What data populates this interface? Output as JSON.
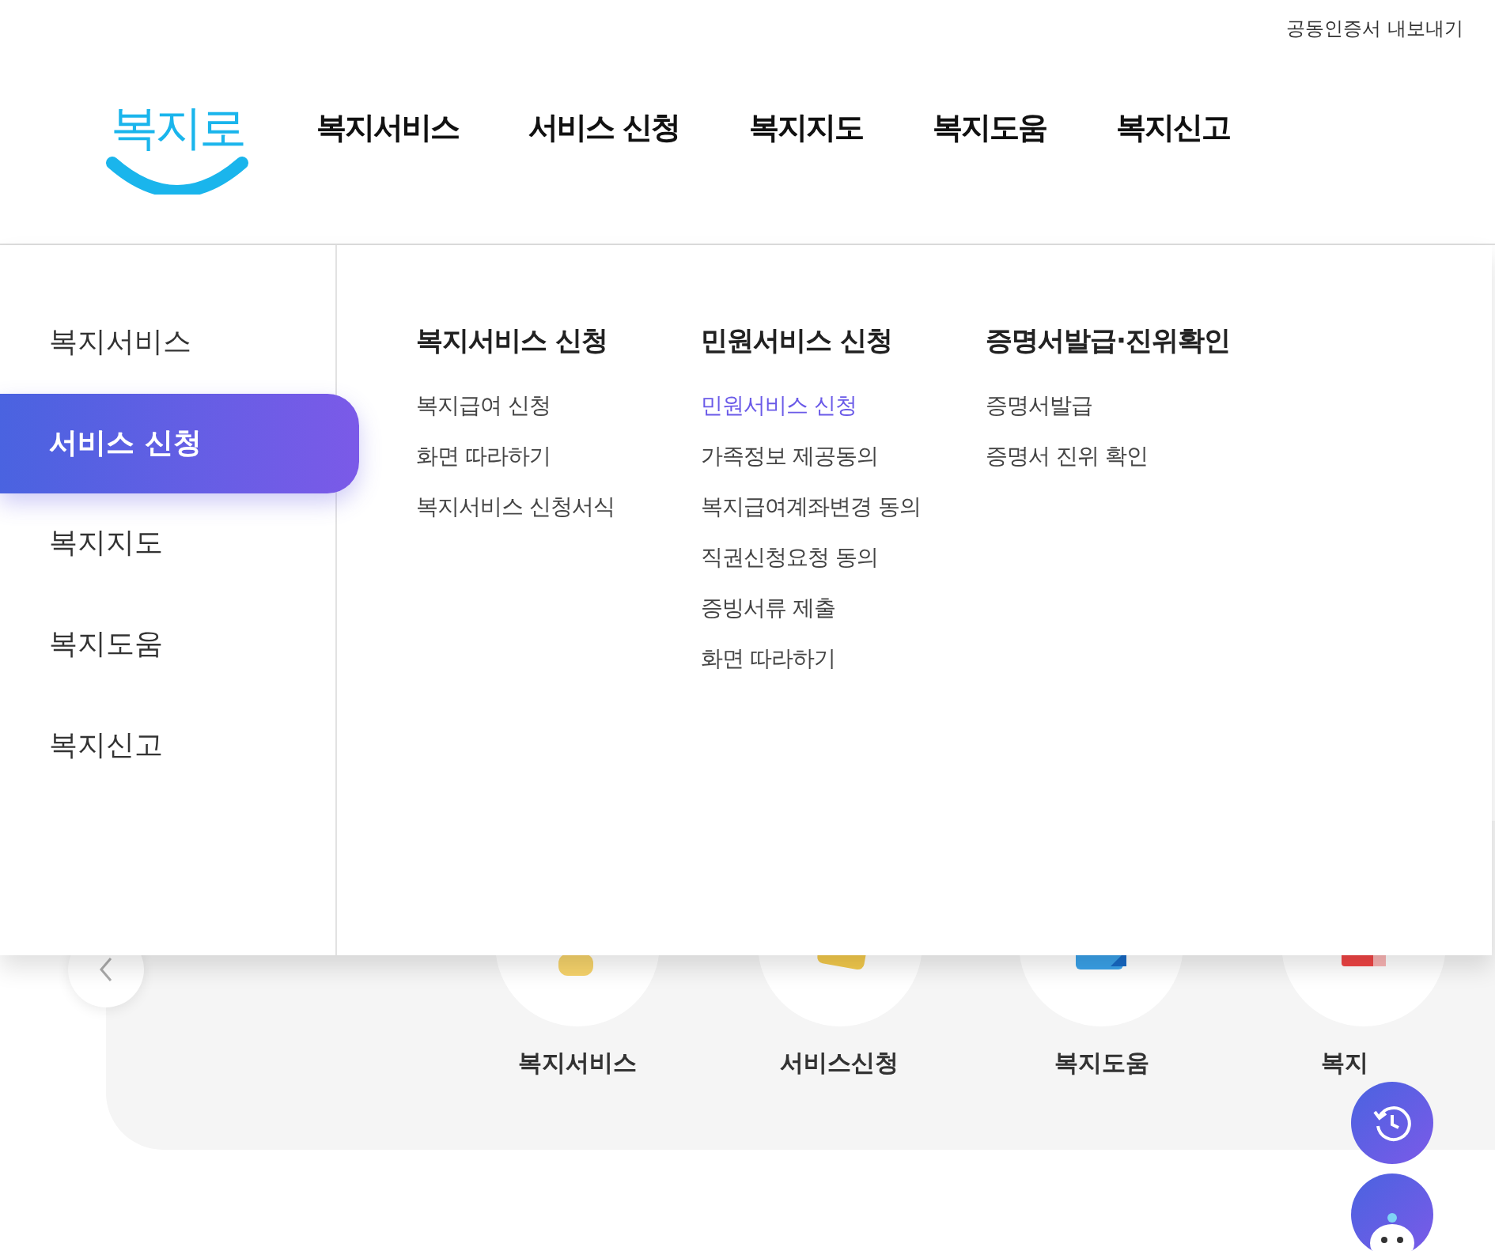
{
  "utility_link": "공동인증서 내보내기",
  "logo": {
    "text": "복지로"
  },
  "nav": [
    "복지서비스",
    "서비스 신청",
    "복지지도",
    "복지도움",
    "복지신고"
  ],
  "mega_menu": {
    "sidebar": [
      {
        "label": "복지서비스",
        "selected": false
      },
      {
        "label": "서비스 신청",
        "selected": true
      },
      {
        "label": "복지지도",
        "selected": false
      },
      {
        "label": "복지도움",
        "selected": false
      },
      {
        "label": "복지신고",
        "selected": false
      }
    ],
    "columns": [
      {
        "title": "복지서비스 신청",
        "items": [
          {
            "label": "복지급여 신청",
            "selected": false
          },
          {
            "label": "화면 따라하기",
            "selected": false
          },
          {
            "label": "복지서비스 신청서식",
            "selected": false
          }
        ]
      },
      {
        "title": "민원서비스 신청",
        "items": [
          {
            "label": "민원서비스 신청",
            "selected": true
          },
          {
            "label": "가족정보 제공동의",
            "selected": false
          },
          {
            "label": "복지급여계좌변경 동의",
            "selected": false
          },
          {
            "label": "직권신청요청 동의",
            "selected": false
          },
          {
            "label": "증빙서류 제출",
            "selected": false
          },
          {
            "label": "화면 따라하기",
            "selected": false
          }
        ]
      },
      {
        "title": "증명서발급·진위확인",
        "items": [
          {
            "label": "증명서발급",
            "selected": false
          },
          {
            "label": "증명서 진위 확인",
            "selected": false
          }
        ]
      }
    ]
  },
  "quick_menu": {
    "tiles": [
      {
        "label": "복지서비스",
        "kind": "person"
      },
      {
        "label": "서비스신청",
        "kind": "hand"
      },
      {
        "label": "복지도움",
        "kind": "folder"
      },
      {
        "label": "복지",
        "kind": "report"
      }
    ]
  }
}
